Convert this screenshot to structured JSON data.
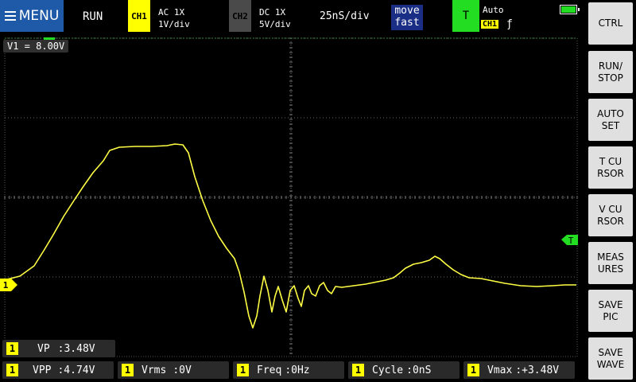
{
  "header": {
    "menu_label": "MENU",
    "run_status": "RUN",
    "ch1": {
      "name": "CH1",
      "coupling": "AC  1X",
      "scale": "1V/div",
      "color": "#ffff00"
    },
    "ch2": {
      "name": "CH2",
      "coupling": "DC  1X",
      "scale": "5V/div",
      "color": "#4a4a4a"
    },
    "timebase": "25nS/div",
    "move": {
      "line1": "move",
      "line2": "fast"
    },
    "trigger": {
      "label": "T",
      "mode": "Auto",
      "channel": "CH1",
      "edge": "ƒ",
      "color": "#22dd22"
    },
    "battery_icon": "battery-icon"
  },
  "side_buttons": [
    {
      "id": "ctrl",
      "label": "CTRL"
    },
    {
      "id": "run-stop",
      "label": "RUN/\nSTOP"
    },
    {
      "id": "auto-set",
      "label": "AUTO\nSET"
    },
    {
      "id": "t-cursor",
      "label": "T CU\nRSOR"
    },
    {
      "id": "v-cursor",
      "label": "V CU\nRSOR"
    },
    {
      "id": "measures",
      "label": "MEAS\nURES"
    },
    {
      "id": "save-pic",
      "label": "SAVE\nPIC"
    },
    {
      "id": "save-wave",
      "label": "SAVE\nWAVE"
    }
  ],
  "screen": {
    "v1_readout": "V1 = 8.00V",
    "ch1_marker": "1",
    "trigger_marker": "T",
    "trace_color": "#ffff44"
  },
  "measurements": {
    "vp": {
      "num": "1",
      "label": "VP",
      "value": ":3.48V"
    },
    "vpp": {
      "num": "1",
      "label": "VPP",
      "value": ":4.74V"
    },
    "vrms": {
      "num": "1",
      "label": "Vrms",
      "value": ":0V"
    },
    "freq": {
      "num": "1",
      "label": "Freq",
      "value": ":0Hz"
    },
    "cycle": {
      "num": "1",
      "label": "Cycle",
      "value": ":0nS"
    },
    "vmax": {
      "num": "1",
      "label": "Vmax",
      "value": ":+3.48V"
    }
  }
}
